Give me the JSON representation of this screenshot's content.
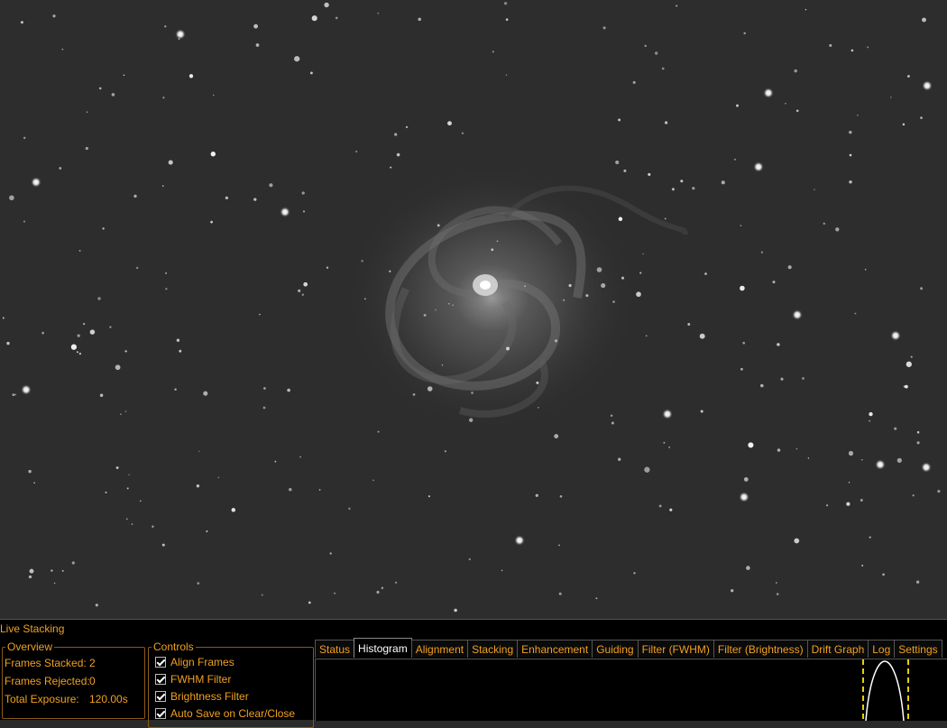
{
  "panel": {
    "title": "Live Stacking"
  },
  "overview": {
    "legend": "Overview",
    "rows": [
      {
        "label": "Frames Stacked:",
        "value": "2"
      },
      {
        "label": "Frames Rejected:",
        "value": "0"
      },
      {
        "label": "Total Exposure:",
        "value": "120.00s"
      }
    ]
  },
  "controls": {
    "legend": "Controls",
    "items": [
      {
        "label": "Align Frames",
        "checked": true
      },
      {
        "label": "FWHM Filter",
        "checked": true
      },
      {
        "label": "Brightness Filter",
        "checked": true
      },
      {
        "label": "Auto Save on Clear/Close",
        "checked": true
      }
    ]
  },
  "tabs": [
    {
      "label": "Status",
      "active": false
    },
    {
      "label": "Histogram",
      "active": true
    },
    {
      "label": "Alignment",
      "active": false
    },
    {
      "label": "Stacking",
      "active": false
    },
    {
      "label": "Enhancement",
      "active": false
    },
    {
      "label": "Guiding",
      "active": false
    },
    {
      "label": "Filter (FWHM)",
      "active": false
    },
    {
      "label": "Filter (Brightness)",
      "active": false
    },
    {
      "label": "Drift Graph",
      "active": false
    },
    {
      "label": "Log",
      "active": false
    },
    {
      "label": "Settings",
      "active": false
    }
  ],
  "colors": {
    "accent": "#f0a020",
    "sky": "#2d2d2d",
    "panel_bg": "#000000",
    "histogram_marker": "#e6d200"
  }
}
